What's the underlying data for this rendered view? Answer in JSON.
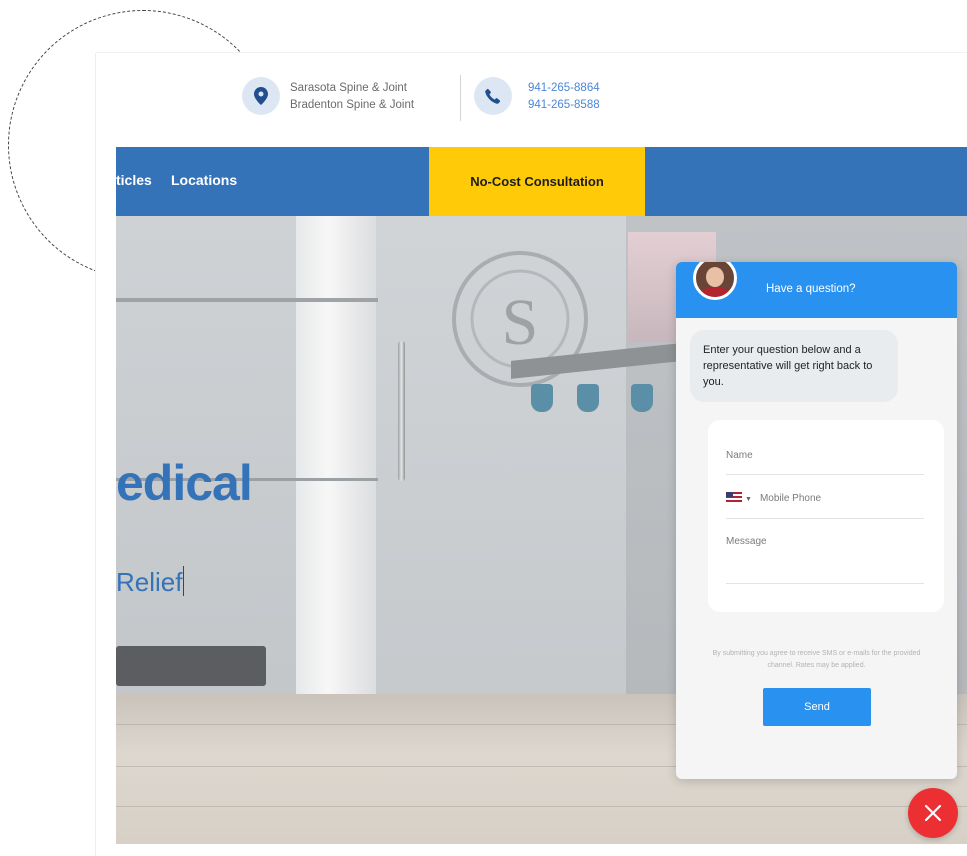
{
  "header": {
    "locations": [
      "Sarasota Spine & Joint",
      "Bradenton Spine & Joint"
    ],
    "phones": [
      "941-265-8864",
      "941-265-8588"
    ]
  },
  "nav": {
    "items": [
      {
        "label": "ticles"
      },
      {
        "label": "Locations"
      }
    ],
    "cta_label": "No-Cost Consultation"
  },
  "hero": {
    "headline": "edical",
    "subline": "Relief"
  },
  "chat": {
    "title": "Have a question?",
    "intro": "Enter your question below and a representative will get right back to you.",
    "name_placeholder": "Name",
    "phone_placeholder": "Mobile Phone",
    "message_placeholder": "Message",
    "consent": "By submitting you agree to receive SMS or e-mails for the provided channel. Rates may be applied.",
    "send_label": "Send"
  },
  "icons": {
    "location": "map-pin-icon",
    "phone": "phone-icon",
    "close": "close-icon"
  },
  "colors": {
    "brand_blue": "#3573b9",
    "cta_yellow": "#ffcb08",
    "chat_blue": "#2991f0",
    "close_red": "#ec2f33"
  }
}
